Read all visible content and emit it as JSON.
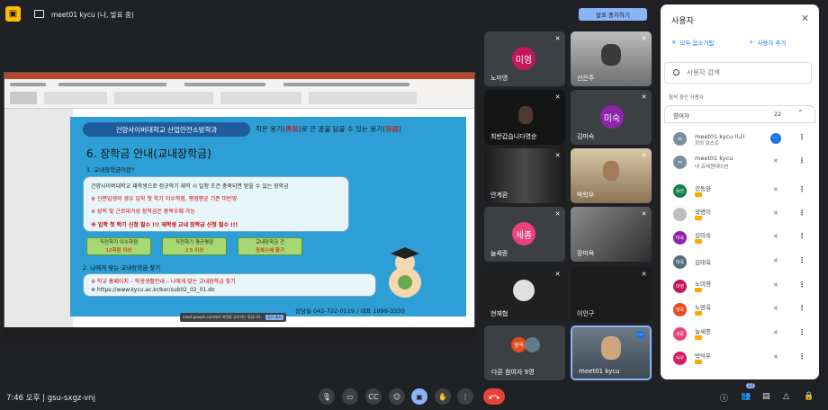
{
  "topbar": {
    "meeting_label": "meet01 kycu (나, 발표 중)",
    "stop_label": "발표 중지하기"
  },
  "slide": {
    "banner": "건양사이버대학교 산업안전소방학과",
    "quote_pre": "작은 용기(",
    "quote_red": "勇氣",
    "quote_mid": ")로 큰 꿈을 담을 수 있는 용기(",
    "quote_red2": "容器",
    "quote_post": ")",
    "heading": "6. 장학금 안내(교내장학금)",
    "sub1": "1. 교내장학금이란?",
    "lines": [
      "건양사이버대학교 재학생으로 정규학기 재학 시 일정 조건 충족되면 받을 수 있는 장학금",
      "※ 신편입생의 경우 입학 첫 학기 이수학점, 평점평균 기준 미반영",
      "※ 성적 및 근로대가성 장학금은 중복수혜 가능",
      "※ 입학 첫 학기 신청 필수 !!! 재학생 교내 장학금 신청 필수 !!!"
    ],
    "cards": [
      {
        "title": "직전학기 이수학점",
        "value": "12학점 이상"
      },
      {
        "title": "직전학기 평균평점",
        "value": "2.5 이상"
      },
      {
        "title": "교내장학금 간",
        "value": "중복수혜 불가"
      }
    ],
    "sub2": "2. 나에게 맞는 교내장학금 찾기",
    "box2_line1": "※ 학교 홈페이지 – 학생생활안내 – 나에게 맞는 교내장학금 찾기",
    "box2_line2": "※ https://www.kycu.ac.kr/kor/sub02_02_01.do",
    "footer": "상담실 042-722-0119  /  대표 1899-3330"
  },
  "toast": {
    "text": "meet.google.com에서 화면을 공유하는 중입니다.",
    "button": "공유 중지"
  },
  "tiles": [
    {
      "name": "노미영",
      "avatar": "미영",
      "color": "#c2185b"
    },
    {
      "name": "신은주"
    },
    {
      "name": "최반갑습니다영순"
    },
    {
      "name": "김미숙",
      "avatar": "미숙",
      "color": "#8e24aa"
    },
    {
      "name": "안계환"
    },
    {
      "name": "박학우"
    },
    {
      "name": "늘세종",
      "avatar": "세종",
      "color": "#ec407a"
    },
    {
      "name": "장미옥"
    },
    {
      "name": "현재협"
    },
    {
      "name": "이인구"
    },
    {
      "name": "다른 참여자 9명",
      "avatar": "영옥",
      "color": "#e64a19"
    },
    {
      "name": "meet01 kycu"
    }
  ],
  "bottombar": {
    "time": "7:46 오후",
    "meeting_code": "gsu-sxgz-vnj",
    "participants_count": "22"
  },
  "panel": {
    "title": "사용자",
    "mute_all": "모두 음소거됨",
    "add_user": "사용자 추가",
    "search_placeholder": "사용자 검색",
    "in_call": "참석 중인 사용자",
    "group_label": "참여자",
    "group_count": "22",
    "people": [
      {
        "name": "meet01 kycu (나)",
        "sub": "회의 호스트",
        "avatar": "m",
        "color": "#78909c"
      },
      {
        "name": "meet01 kycu",
        "sub": "내 프레젠테이션",
        "avatar": "m",
        "color": "#78909c"
      },
      {
        "name": "강동완",
        "avatar": "동완",
        "color": "#0b8043"
      },
      {
        "name": "곽명이",
        "avatar": "",
        "color": "#bdbdbd"
      },
      {
        "name": "김미숙",
        "avatar": "미숙",
        "color": "#8e24aa"
      },
      {
        "name": "김태옥",
        "avatar": "태옥",
        "color": "#546e7a"
      },
      {
        "name": "노미영",
        "avatar": "미영",
        "color": "#c2185b"
      },
      {
        "name": "노영옥",
        "avatar": "영옥",
        "color": "#e64a19"
      },
      {
        "name": "늘세종",
        "avatar": "세종",
        "color": "#ec407a"
      },
      {
        "name": "박덕우",
        "avatar": "덕우",
        "color": "#d81b60"
      }
    ]
  },
  "colors": {
    "accent": "#8ab4f8",
    "end_call": "#ea4335",
    "panel_link": "#1a73e8"
  }
}
